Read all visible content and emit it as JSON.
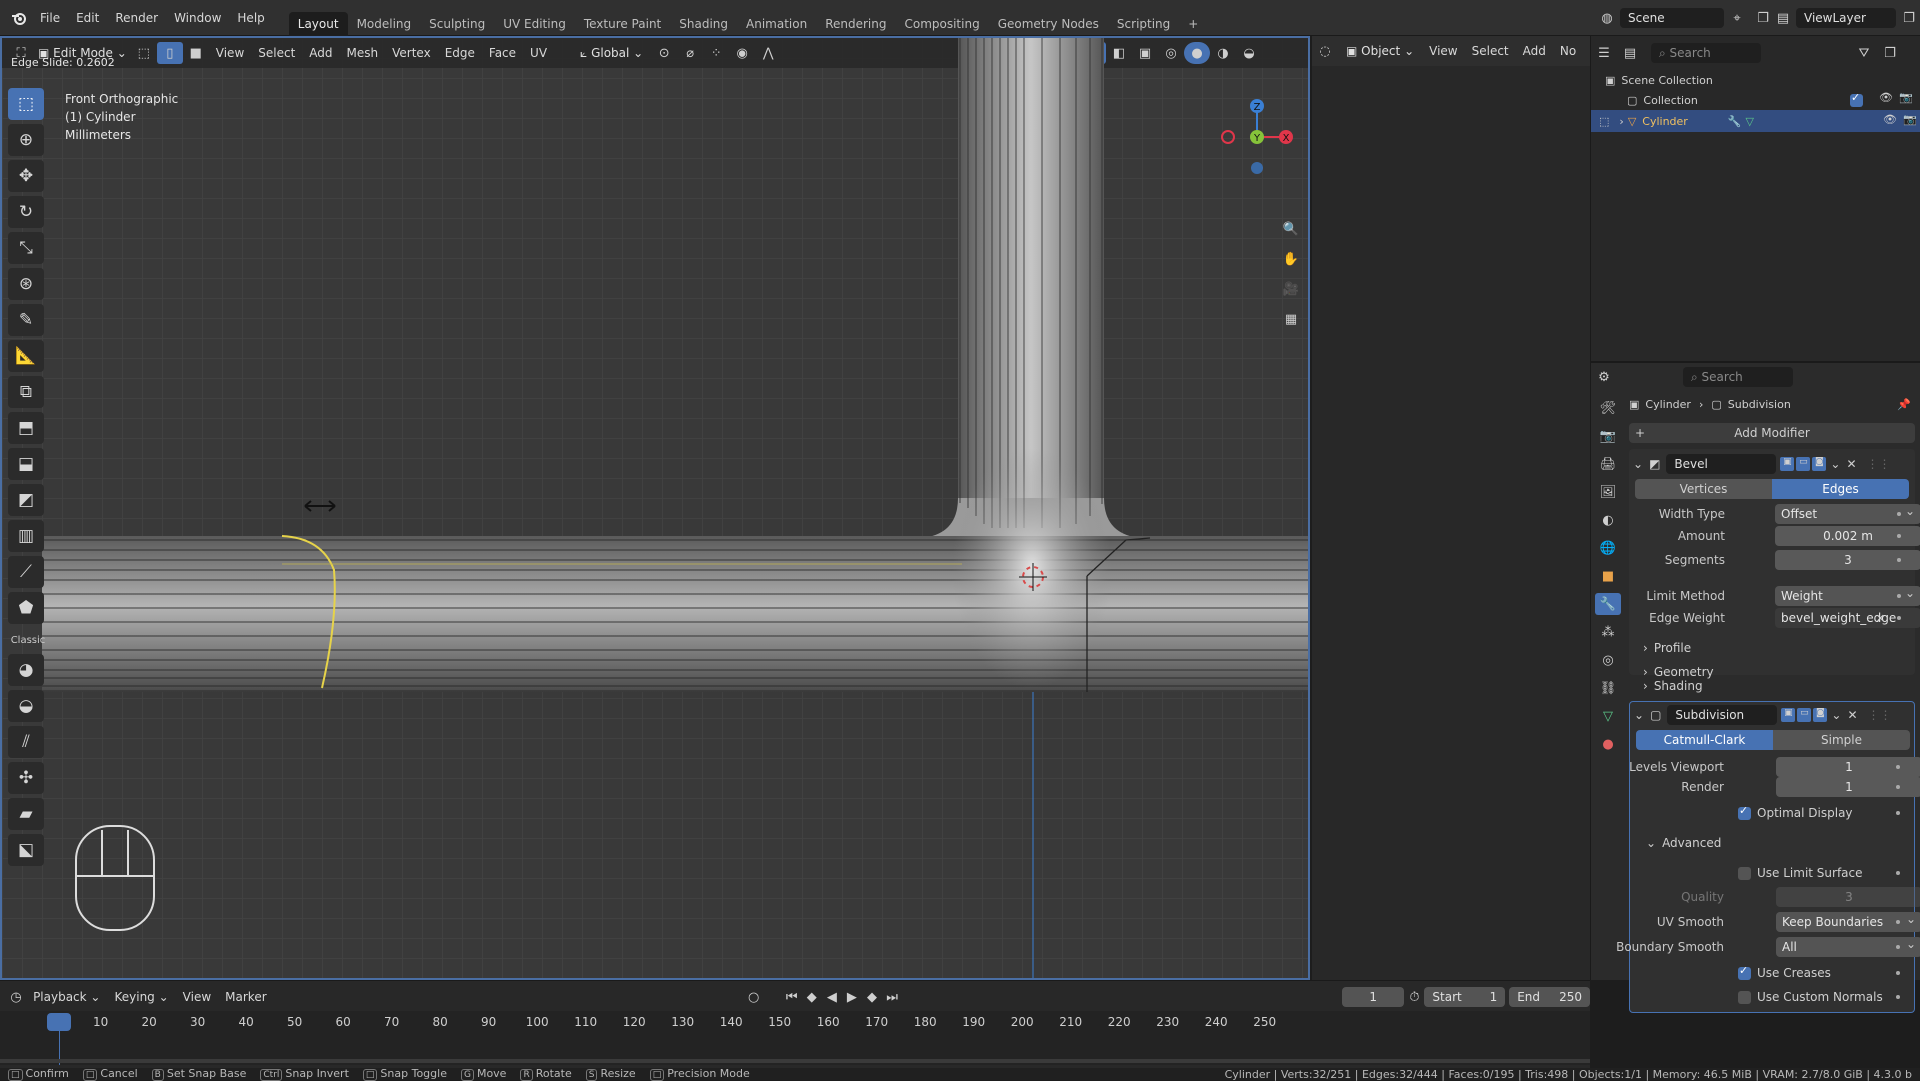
{
  "colors": {
    "accent": "#4772b3",
    "viewport_border": "#4a6ea3",
    "edge_selected": "#e6d34a",
    "axis_x": "#e0364a",
    "axis_y": "#86c33a",
    "axis_z": "#3a7fd4"
  },
  "topbar": {
    "menus": [
      "File",
      "Edit",
      "Render",
      "Window",
      "Help"
    ],
    "workspaces": [
      "Layout",
      "Modeling",
      "Sculpting",
      "UV Editing",
      "Texture Paint",
      "Shading",
      "Animation",
      "Rendering",
      "Compositing",
      "Geometry Nodes",
      "Scripting"
    ],
    "active_workspace": "Layout",
    "add_tab": "+",
    "scene_label": "Scene",
    "view_layer_label": "ViewLayer"
  },
  "viewport": {
    "mode": "Edit Mode",
    "menus": [
      "View",
      "Select",
      "Add",
      "Mesh",
      "Vertex",
      "Edge",
      "Face",
      "UV"
    ],
    "transform_orientation": "Global",
    "operator_status": "Edge Slide: 0.2602",
    "overlay_lines": [
      "Front Orthographic",
      "(1) Cylinder",
      "Millimeters"
    ],
    "gizmo": {
      "x": "X",
      "y": "Y",
      "z": "Z"
    }
  },
  "toolbar": {
    "classic_label": "Classic"
  },
  "right_header": {
    "mode": "Object",
    "menus": [
      "View",
      "Select",
      "Add",
      "No"
    ]
  },
  "outliner": {
    "search_placeholder": "Search",
    "items": [
      {
        "label": "Scene Collection"
      },
      {
        "label": "Collection"
      },
      {
        "label": "Cylinder"
      }
    ]
  },
  "properties": {
    "search_placeholder": "Search",
    "breadcrumb": [
      "Cylinder",
      "Subdivision"
    ],
    "add_modifier": "Add Modifier",
    "bevel": {
      "name": "Bevel",
      "tabs": [
        "Vertices",
        "Edges"
      ],
      "active_tab": "Edges",
      "width_type_label": "Width Type",
      "width_type": "Offset",
      "amount_label": "Amount",
      "amount": "0.002 m",
      "segments_label": "Segments",
      "segments": "3",
      "limit_method_label": "Limit Method",
      "limit_method": "Weight",
      "edge_weight_label": "Edge Weight",
      "edge_weight": "bevel_weight_edge",
      "subpanels": [
        "Profile",
        "Geometry",
        "Shading"
      ]
    },
    "subdivision": {
      "name": "Subdivision",
      "tabs": [
        "Catmull-Clark",
        "Simple"
      ],
      "active_tab": "Catmull-Clark",
      "levels_viewport_label": "Levels Viewport",
      "levels_viewport": "1",
      "render_label": "Render",
      "render": "1",
      "optimal_display": "Optimal Display",
      "advanced": "Advanced",
      "use_limit_surface": "Use Limit Surface",
      "quality_label": "Quality",
      "quality": "3",
      "uv_smooth_label": "UV Smooth",
      "uv_smooth": "Keep Boundaries",
      "boundary_smooth_label": "Boundary Smooth",
      "boundary_smooth": "All",
      "use_creases": "Use Creases",
      "use_custom_normals": "Use Custom Normals"
    }
  },
  "timeline": {
    "menus": [
      "Playback",
      "Keying",
      "View",
      "Marker"
    ],
    "current_frame": "1",
    "start_label": "Start",
    "start": "1",
    "end_label": "End",
    "end": "250",
    "ticks": [
      "1",
      "10",
      "20",
      "30",
      "40",
      "50",
      "60",
      "70",
      "80",
      "90",
      "100",
      "110",
      "120",
      "130",
      "140",
      "150",
      "160",
      "170",
      "180",
      "190",
      "200",
      "210",
      "220",
      "230",
      "240",
      "250"
    ]
  },
  "statusbar": {
    "hints": [
      "Confirm",
      "Cancel",
      "Set Snap Base",
      "Snap Invert",
      "Snap Toggle",
      "Move",
      "Rotate",
      "Resize",
      "Precision Mode"
    ],
    "keys": [
      "",
      "",
      "B",
      "Ctrl",
      "",
      "G",
      "R",
      "S",
      ""
    ],
    "stats": "Cylinder | Verts:32/251 | Edges:32/444 | Faces:0/195 | Tris:498 | Objects:1/1 | Memory: 46.5 MiB | VRAM: 2.7/8.0 GiB | 4.3.0 b"
  }
}
